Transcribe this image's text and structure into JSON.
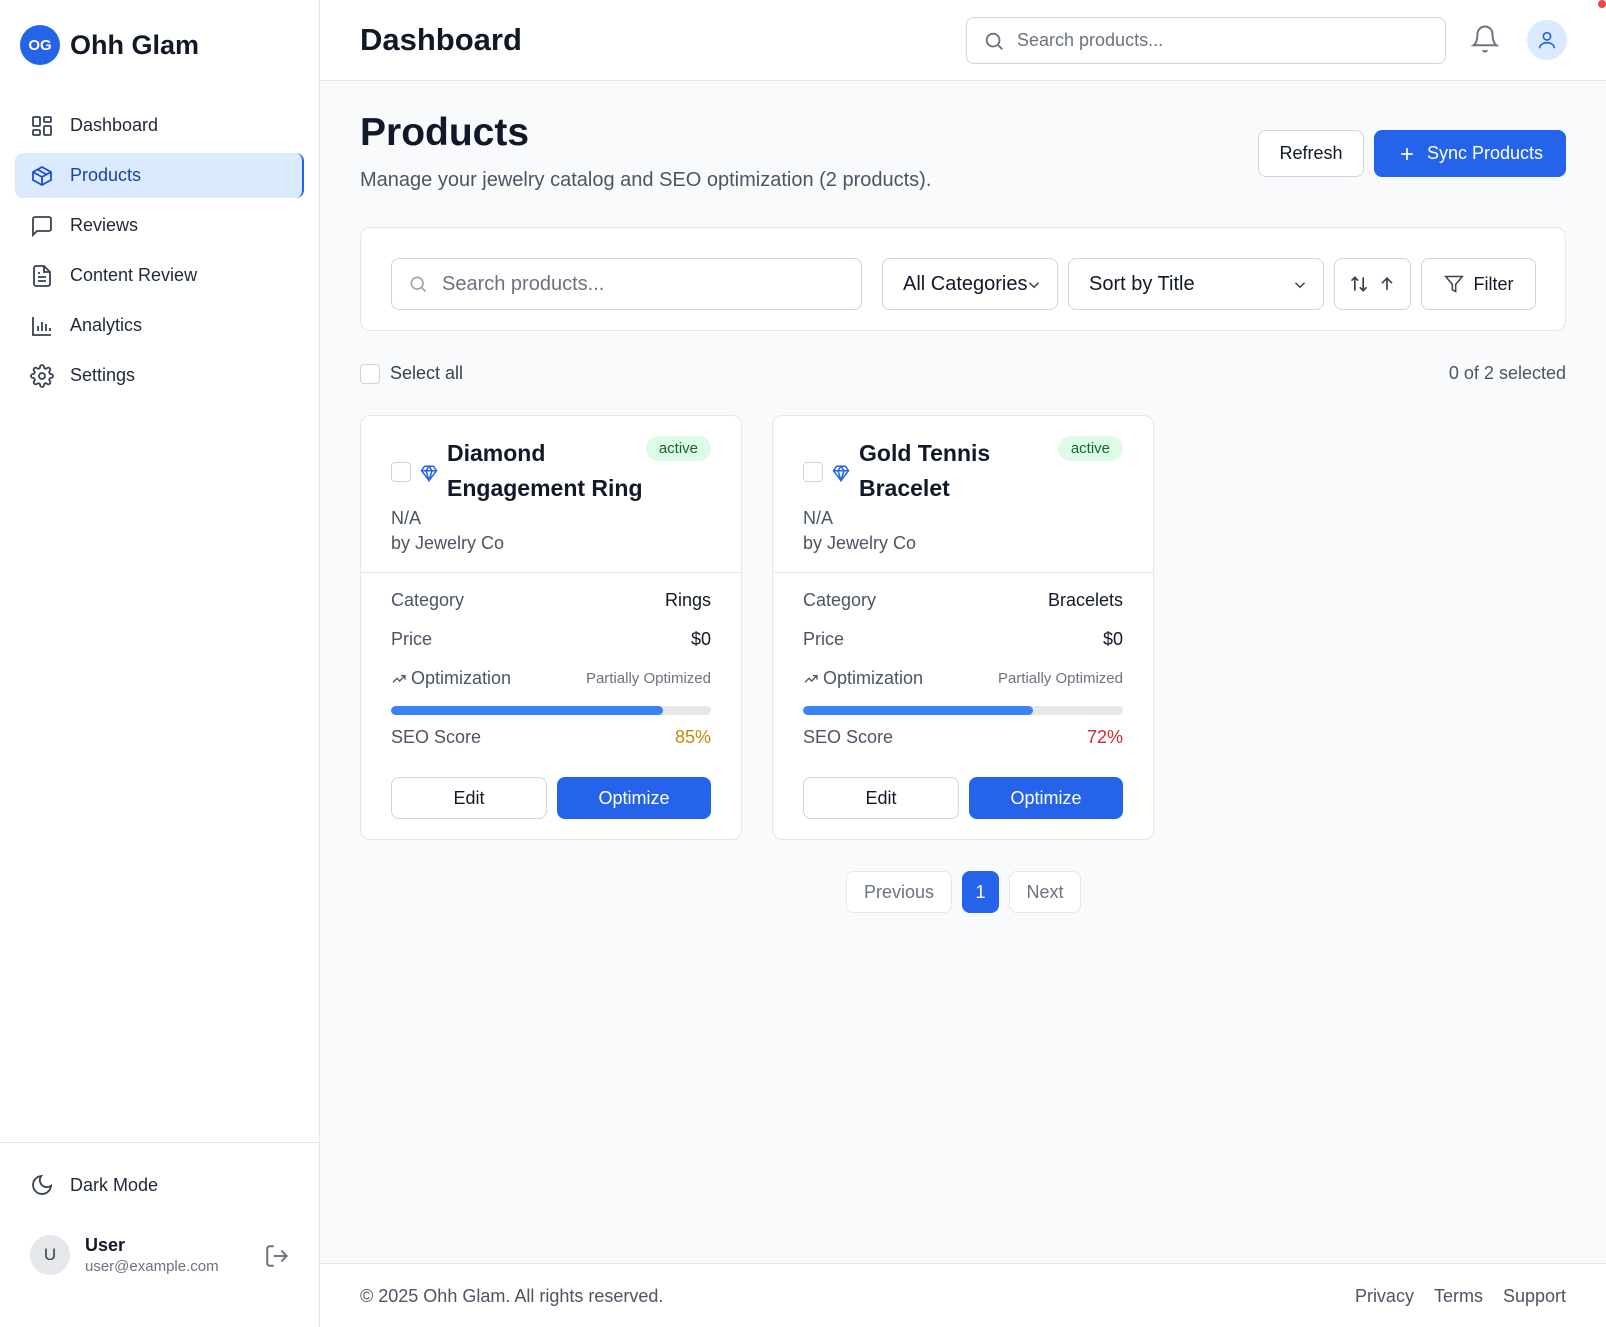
{
  "brand": {
    "logo_text": "OG",
    "name": "Ohh Glam"
  },
  "sidebar": {
    "items": [
      {
        "label": "Dashboard",
        "icon": "layout-grid-icon"
      },
      {
        "label": "Products",
        "icon": "package-icon",
        "active": true
      },
      {
        "label": "Reviews",
        "icon": "message-square-icon"
      },
      {
        "label": "Content Review",
        "icon": "file-text-icon"
      },
      {
        "label": "Analytics",
        "icon": "bar-chart-icon"
      },
      {
        "label": "Settings",
        "icon": "gear-icon"
      }
    ],
    "dark_mode_label": "Dark Mode",
    "user": {
      "initial": "U",
      "name": "User",
      "email": "user@example.com"
    }
  },
  "header": {
    "title": "Dashboard",
    "search_placeholder": "Search products..."
  },
  "main": {
    "title": "Products",
    "subtitle": "Manage your jewelry catalog and SEO optimization (2 products).",
    "refresh_label": "Refresh",
    "sync_label": "Sync Products",
    "filters": {
      "search_placeholder": "Search products...",
      "category_value": "All Categories",
      "sort_value": "Sort by Title",
      "filter_label": "Filter"
    },
    "select_all_label": "Select all",
    "selected_count": "0 of 2 selected",
    "products": [
      {
        "title": "Diamond Engagement Ring",
        "status": "active",
        "sku": "N/A",
        "vendor": "by Jewelry Co",
        "category_label": "Category",
        "category": "Rings",
        "price_label": "Price",
        "price": "$0",
        "optimization_label": "Optimization",
        "optimization_status": "Partially Optimized",
        "seo_label": "SEO Score",
        "seo_score": "85%",
        "seo_value": 0.85,
        "seo_color": "#ca8a04",
        "edit_label": "Edit",
        "optimize_label": "Optimize"
      },
      {
        "title": "Gold Tennis Bracelet",
        "status": "active",
        "sku": "N/A",
        "vendor": "by Jewelry Co",
        "category_label": "Category",
        "category": "Bracelets",
        "price_label": "Price",
        "price": "$0",
        "optimization_label": "Optimization",
        "optimization_status": "Partially Optimized",
        "seo_label": "SEO Score",
        "seo_score": "72%",
        "seo_value": 0.72,
        "seo_color": "#dc2626",
        "edit_label": "Edit",
        "optimize_label": "Optimize"
      }
    ],
    "pagination": {
      "previous": "Previous",
      "current": "1",
      "next": "Next"
    }
  },
  "footer": {
    "copyright": "© 2025 Ohh Glam. All rights reserved.",
    "links": [
      "Privacy",
      "Terms",
      "Support"
    ]
  },
  "colors": {
    "accent": "#2563eb",
    "active_bg": "#dbeafe",
    "badge_bg": "#dcfce7",
    "badge_text": "#166534"
  }
}
